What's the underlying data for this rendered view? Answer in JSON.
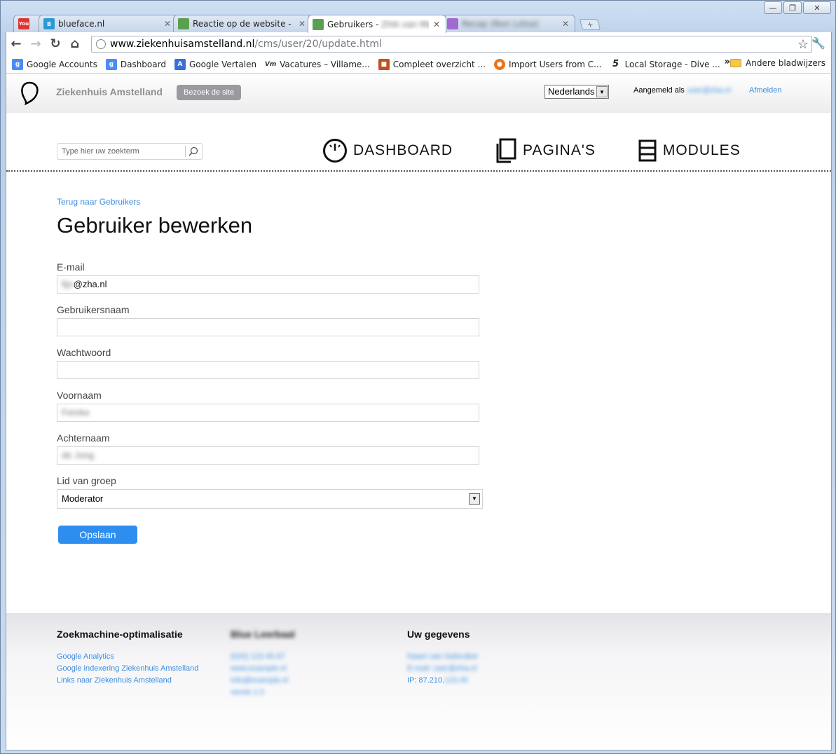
{
  "browser": {
    "tabs": [
      {
        "title": "",
        "favicon": "youtube-icon",
        "color": "#d33"
      },
      {
        "title": "blueface.nl",
        "favicon": "blueface-icon",
        "color": "#2a9ad6"
      },
      {
        "title": "Reactie op de website - Ziek",
        "favicon": "cms-icon",
        "color": "#5aa050"
      },
      {
        "title": "Gebruikers - ",
        "favicon": "cms-icon",
        "color": "#5aa050"
      },
      {
        "title": "",
        "favicon": "colorful-icon",
        "color": "#a06ad0"
      }
    ],
    "url_host": "www.ziekenhuisamstelland.nl",
    "url_path": "/cms/user/20/update.html",
    "bookmarks": [
      {
        "label": "Google Accounts",
        "icon": "google-icon",
        "color": "#4b8bf5"
      },
      {
        "label": "Dashboard",
        "icon": "google-icon",
        "color": "#4b8bf5"
      },
      {
        "label": "Google Vertalen",
        "icon": "translate-icon",
        "color": "#3a6fd8"
      },
      {
        "label": "Vacatures – Villame...",
        "icon": "vm-icon",
        "color": "#333"
      },
      {
        "label": "Compleet overzicht ...",
        "icon": "person-icon",
        "color": "#c05020"
      },
      {
        "label": "Import Users from C...",
        "icon": "firefox-icon",
        "color": "#e8751a"
      },
      {
        "label": "Local Storage - Dive ...",
        "icon": "five-icon",
        "color": "#222"
      }
    ],
    "bookmarks_more": "»",
    "other_bookmarks": "Andere bladwijzers"
  },
  "header": {
    "site_name": "Ziekenhuis Amstelland",
    "visit_label": "Bezoek de site",
    "language": "Nederlands",
    "logged_in_label": "Aangemeld als",
    "logout_label": "Afmelden"
  },
  "search": {
    "placeholder": "Type hier uw zoekterm"
  },
  "nav": {
    "dashboard": "DASHBOARD",
    "pages": "PAGINA'S",
    "modules": "MODULES"
  },
  "form": {
    "back_link": "Terug naar Gebruikers",
    "title": "Gebruiker bewerken",
    "email_label": "E-mail",
    "email_value": "@zha.nl",
    "username_label": "Gebruikersnaam",
    "password_label": "Wachtwoord",
    "firstname_label": "Voornaam",
    "lastname_label": "Achternaam",
    "group_label": "Lid van groep",
    "group_value": "Moderator",
    "save_label": "Opslaan"
  },
  "footer": {
    "seo_title": "Zoekmachine-optimalisatie",
    "seo_links": [
      "Google Analytics",
      "Google indexering Ziekenhuis Amstelland",
      "Links naar Ziekenhuis Amstelland"
    ],
    "data_title": "Uw gegevens",
    "ip_prefix": "IP: 87.210."
  },
  "colors": {
    "accent": "#2d8ef0",
    "link": "#3b8ee0",
    "visit_button": "#999aa0"
  }
}
